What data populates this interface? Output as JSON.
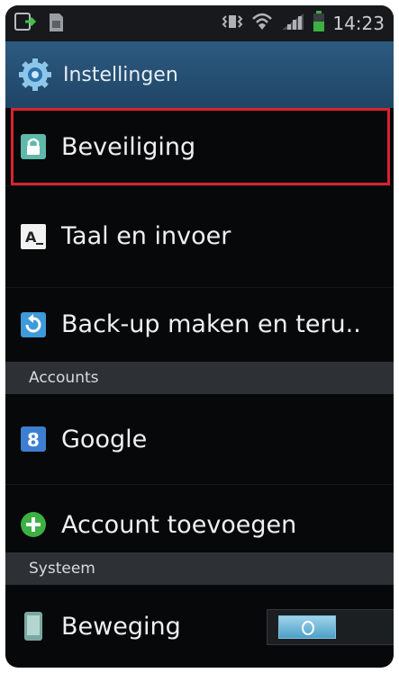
{
  "status_bar": {
    "time": "14:23",
    "icons": [
      "download-icon",
      "sim-card-icon",
      "vibrate-icon",
      "wifi-icon",
      "signal-icon",
      "battery-icon"
    ]
  },
  "title_bar": {
    "title": "Instellingen",
    "icon": "settings-gear-icon"
  },
  "items": [
    {
      "label": "Beveiliging",
      "icon": "lock-icon",
      "highlighted": true
    },
    {
      "label": "Taal en invoer",
      "icon": "keyboard-language-icon"
    },
    {
      "label": "Back-up maken en teru..",
      "icon": "backup-restore-icon"
    }
  ],
  "sections": {
    "accounts": {
      "title": "Accounts",
      "items": [
        {
          "label": "Google",
          "icon": "google-icon"
        },
        {
          "label": "Account toevoegen",
          "icon": "add-account-icon"
        }
      ]
    },
    "system": {
      "title": "Systeem",
      "items": [
        {
          "label": "Beweging",
          "icon": "motion-phone-icon",
          "toggle": "on"
        }
      ]
    }
  },
  "colors": {
    "background": "#070809",
    "titlebar": "#2c5a80",
    "highlight_border": "#d8222f",
    "section_header": "#2d3136",
    "toggle_on": "#4e9fc8"
  }
}
